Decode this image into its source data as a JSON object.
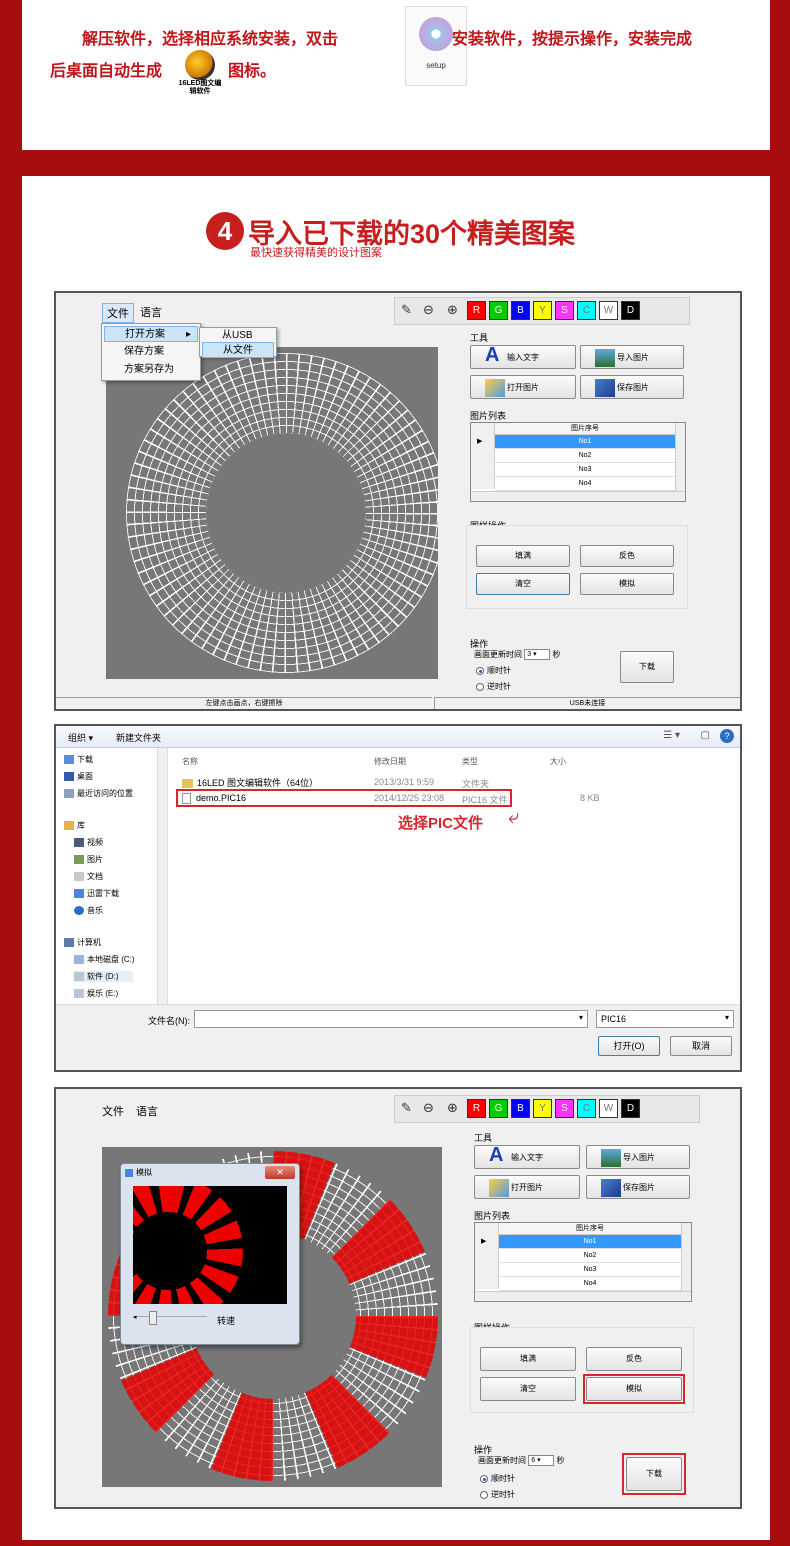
{
  "install": {
    "line1_a": "解压软件，选择相应系统安装，双击",
    "line1_b": "安装软件，按提示操作，安装完成",
    "line2_a": "后桌面自动生成",
    "line2_b": "图标。",
    "app_icon_caption": "16LED图文编辑软件",
    "setup_icon_caption": "setup"
  },
  "step": {
    "number": "4",
    "title": "导入已下载的30个精美图案",
    "subtitle": "最快速获得精美的设计图案"
  },
  "editor": {
    "menu": [
      "文件",
      "语言"
    ],
    "file_menu": [
      "打开方案",
      "保存方案",
      "方案另存为"
    ],
    "submenu": [
      "从USB",
      "从文件"
    ],
    "tool_group": "工具",
    "btn_text": "输入文字",
    "btn_import": "导入图片",
    "btn_open": "打开图片",
    "btn_save": "保存图片",
    "list_group": "图片列表",
    "list_header": "图片序号",
    "list_rows": [
      "No1",
      "No2",
      "No3",
      "No4"
    ],
    "pattern_group": "图样操作",
    "btn_fill": "填满",
    "btn_invert": "反色",
    "btn_clear": "清空",
    "btn_simulate": "模拟",
    "op_group": "操作",
    "refresh_label": "画面更新时间",
    "refresh_value": "3",
    "refresh_value_2": "6",
    "sec": "秒",
    "cw": "顺时针",
    "ccw": "逆时针",
    "btn_download": "下载",
    "status_left": "左键点击画点，右键擦除",
    "status_right": "USB未连接",
    "colors": [
      {
        "label": "R",
        "color": "#ff0000"
      },
      {
        "label": "G",
        "color": "#00cc00"
      },
      {
        "label": "B",
        "color": "#0000ff"
      },
      {
        "label": "Y",
        "color": "#ffff00"
      },
      {
        "label": "S",
        "color": "#ff33ff"
      },
      {
        "label": "C",
        "color": "#00ffff"
      },
      {
        "label": "W",
        "color": "#ffffff"
      },
      {
        "label": "D",
        "color": "#000000"
      }
    ]
  },
  "file_dialog": {
    "organize": "组织 ▾",
    "new_folder": "新建文件夹",
    "nav": [
      "下载",
      "桌面",
      "最近访问的位置",
      "库",
      "视频",
      "图片",
      "文档",
      "迅雷下载",
      "音乐",
      "计算机",
      "本地磁盘 (C:)",
      "软件 (D:)",
      "娱乐 (E:)"
    ],
    "columns": [
      "名称",
      "修改日期",
      "类型",
      "大小"
    ],
    "files": [
      {
        "name": "16LED 图文编辑软件（64位）",
        "date": "2013/3/31 9:59",
        "type": "文件夹",
        "size": ""
      },
      {
        "name": "demo.PIC16",
        "date": "2014/12/25 23:08",
        "type": "PIC16 文件",
        "size": "8 KB"
      }
    ],
    "annotation": "选择PIC文件",
    "filename_label": "文件名(N):",
    "filetype": "PIC16",
    "btn_open": "打开(O)",
    "btn_cancel": "取消"
  },
  "simulate_window": {
    "title": "模拟",
    "speed_label": "转速"
  }
}
